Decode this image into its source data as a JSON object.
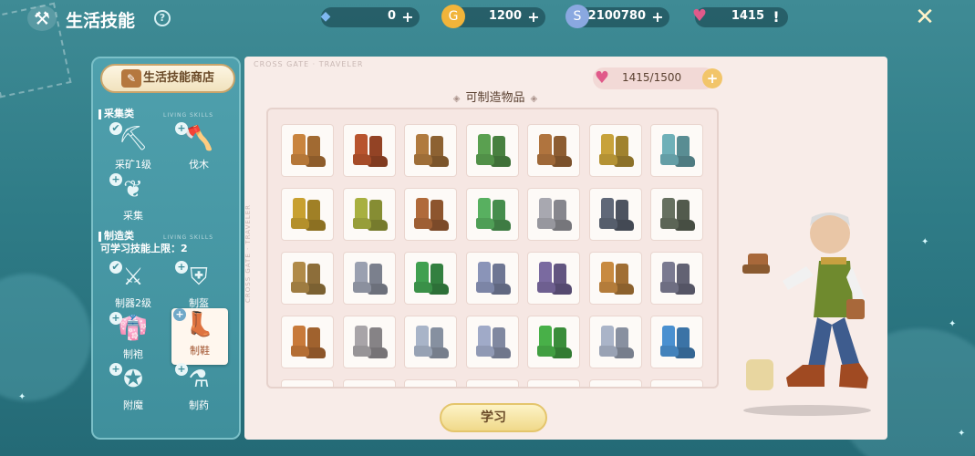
{
  "header": {
    "title": "生活技能",
    "help_icon": "question-icon"
  },
  "resources": [
    {
      "name": "crystal",
      "icon": "diamond-icon",
      "value": "0",
      "color": "#7fb8f0"
    },
    {
      "name": "gold",
      "icon": "coin-icon",
      "value": "1200",
      "color": "#f1b43a"
    },
    {
      "name": "silver",
      "icon": "silver-coin-icon",
      "value": "2100780",
      "color": "#8aa8e0"
    },
    {
      "name": "heart",
      "icon": "heart-icon",
      "value": "1415",
      "color": "#e05a8a"
    }
  ],
  "sidebar": {
    "shop_label": "生活技能商店",
    "gather": {
      "title": "采集类",
      "subtitle": "LIVING SKILLS"
    },
    "gather_skills": [
      {
        "label": "采矿1级",
        "badge": "✔",
        "icon": "pickaxe-icon"
      },
      {
        "label": "伐木",
        "badge": "+",
        "icon": "axe-icon"
      },
      {
        "label": "采集",
        "badge": "+",
        "icon": "leaf-icon"
      }
    ],
    "craft": {
      "title": "制造类",
      "subtitle": "LIVING SKILLS"
    },
    "limit_text": "可学习技能上限：2",
    "craft_skills": [
      {
        "label": "制器2级",
        "badge": "✔",
        "icon": "weapon-icon"
      },
      {
        "label": "制盔",
        "badge": "+",
        "icon": "armor-icon"
      },
      {
        "label": "制袍",
        "badge": "+",
        "icon": "robe-icon"
      },
      {
        "label": "制鞋",
        "badge": "+",
        "icon": "shoe-icon"
      },
      {
        "label": "附魔",
        "badge": "+",
        "icon": "enchant-icon"
      },
      {
        "label": "制药",
        "badge": "+",
        "icon": "potion-icon"
      }
    ]
  },
  "main": {
    "watermark": "CROSS GATE · TRAVELER",
    "heart_value": "1415/1500",
    "section_title": "可制造物品",
    "learn_label": "学习",
    "boots": [
      [
        "#c9843e",
        "#b8542e",
        "#b07a3e",
        "#5aa050",
        "#b0743e",
        "#c8a23a",
        "#6fb0b8"
      ],
      [
        "#c8a030",
        "#a8b040",
        "#b06a3a",
        "#58b060",
        "#a8a8b0",
        "#606878",
        "#667060"
      ],
      [
        "#b08a48",
        "#9aa0b0",
        "#40a050",
        "#8a94b8",
        "#7a6aa0",
        "#c88a40",
        "#7a7a90"
      ],
      [
        "#c87a3a",
        "#a8a4a8",
        "#a8b4c8",
        "#a0aac8",
        "#48b048",
        "#aab4c8",
        "#4a90d0"
      ]
    ]
  }
}
